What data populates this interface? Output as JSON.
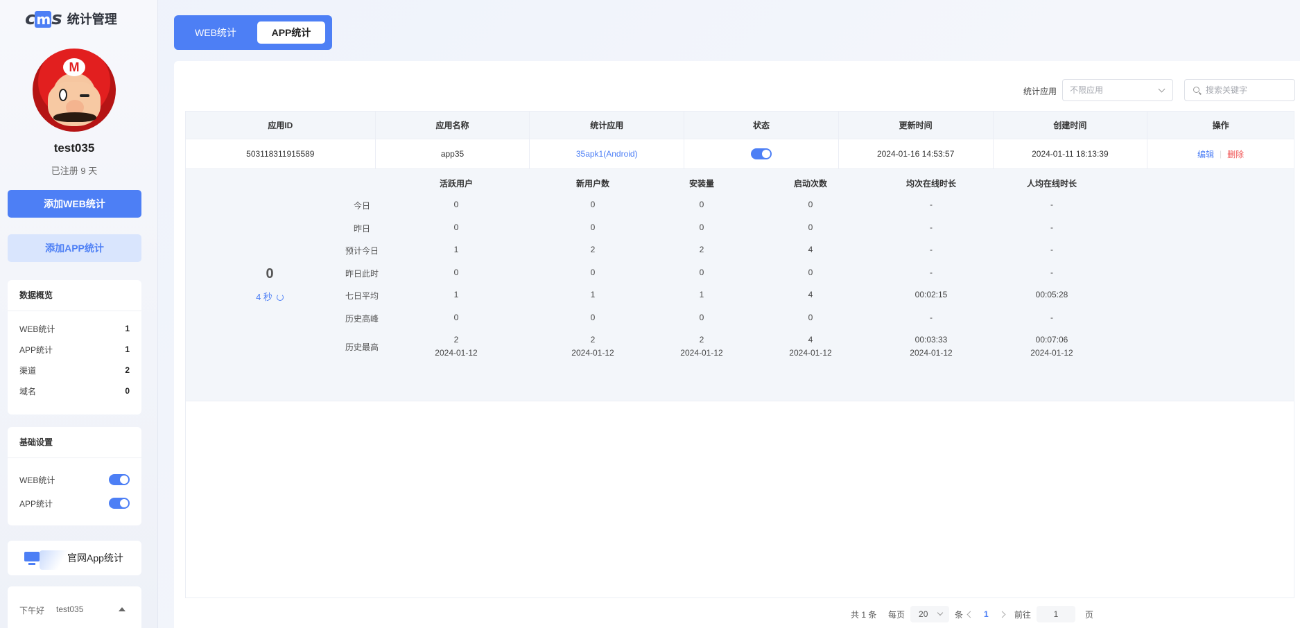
{
  "sidebar": {
    "logo_mark_left": "c",
    "logo_mark_mid": "m",
    "logo_mark_right": "s",
    "logo_text": "统计管理",
    "avatar_badge": "M",
    "username": "test035",
    "registered": "已注册 9 天",
    "add_web_button": "添加WEB统计",
    "add_app_button": "添加APP统计",
    "overview": {
      "title": "数据概览",
      "items": [
        {
          "label": "WEB统计",
          "value": "1"
        },
        {
          "label": "APP统计",
          "value": "1"
        },
        {
          "label": "渠道",
          "value": "2"
        },
        {
          "label": "域名",
          "value": "0"
        }
      ]
    },
    "settings": {
      "title": "基础设置",
      "items": [
        {
          "label": "WEB统计",
          "enabled": true
        },
        {
          "label": "APP统计",
          "enabled": true
        }
      ]
    },
    "promo_text": "官网App统计",
    "greeting": "下午好",
    "greeting_user": "test035"
  },
  "tabs": {
    "web": "WEB统计",
    "app": "APP统计",
    "active": "app"
  },
  "filter": {
    "label": "统计应用",
    "select_placeholder": "不限应用",
    "search_placeholder": "搜索关键字"
  },
  "table": {
    "headers": [
      "应用ID",
      "应用名称",
      "统计应用",
      "状态",
      "更新时间",
      "创建时间",
      "操作"
    ],
    "row": {
      "app_id": "503118311915589",
      "app_name": "app35",
      "stat_app": "35apk1(Android)",
      "status_on": true,
      "updated": "2024-01-16 14:53:57",
      "created": "2024-01-11 18:13:39",
      "edit": "编辑",
      "delete": "删除"
    }
  },
  "metrics": {
    "online_count": "0",
    "refresh_text": "4 秒",
    "columns": [
      "活跃用户",
      "新用户数",
      "安装量",
      "启动次数",
      "均次在线时长",
      "人均在线时长"
    ],
    "rows": [
      {
        "label": "今日",
        "values": [
          "0",
          "0",
          "0",
          "0",
          "-",
          "-"
        ]
      },
      {
        "label": "昨日",
        "values": [
          "0",
          "0",
          "0",
          "0",
          "-",
          "-"
        ]
      },
      {
        "label": "预计今日",
        "values": [
          "1",
          "2",
          "2",
          "4",
          "-",
          "-"
        ]
      },
      {
        "label": "昨日此时",
        "values": [
          "0",
          "0",
          "0",
          "0",
          "-",
          "-"
        ]
      },
      {
        "label": "七日平均",
        "values": [
          "1",
          "1",
          "1",
          "4",
          "00:02:15",
          "00:05:28"
        ]
      },
      {
        "label": "历史高峰",
        "values": [
          "0",
          "0",
          "0",
          "0",
          "-",
          "-"
        ]
      }
    ],
    "max_row": {
      "label": "历史最高",
      "values": [
        "2",
        "2",
        "2",
        "4",
        "00:03:33",
        "00:07:06"
      ],
      "dates": [
        "2024-01-12",
        "2024-01-12",
        "2024-01-12",
        "2024-01-12",
        "2024-01-12",
        "2024-01-12"
      ]
    }
  },
  "pagination": {
    "total": "共 1 条",
    "per_page_label": "每页",
    "per_page": "20",
    "per_page_unit": "条",
    "current": "1",
    "goto_label": "前往",
    "goto_value": "1",
    "page_unit": "页"
  }
}
